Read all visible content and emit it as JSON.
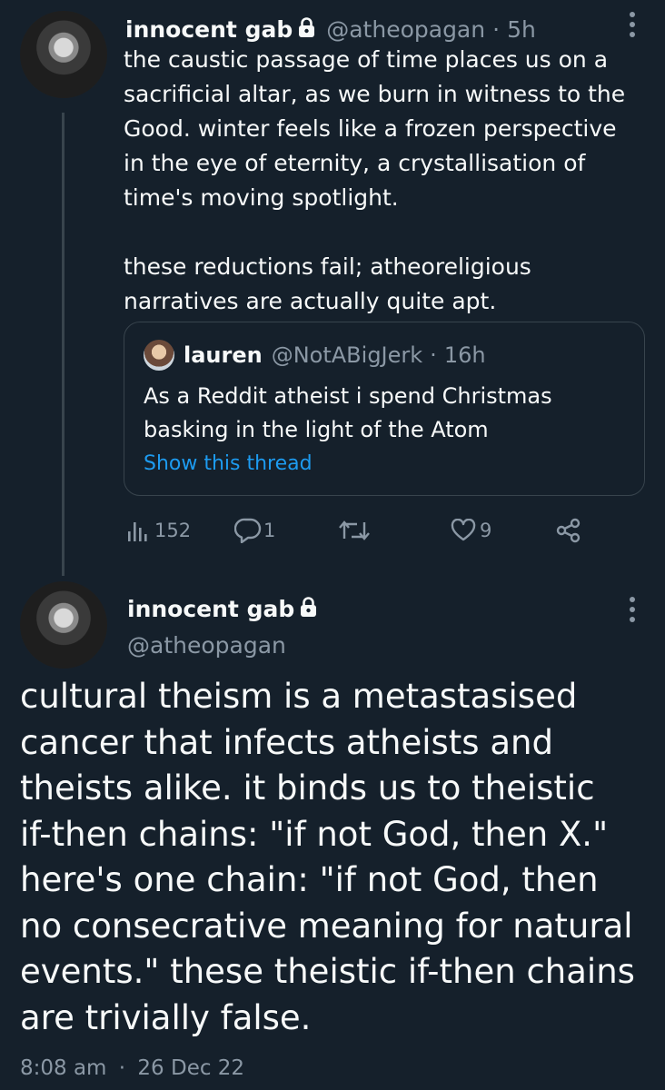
{
  "tweet1": {
    "display_name": "innocent gab",
    "handle": "@atheopagan",
    "sep": "·",
    "time": "5h",
    "text": "the caustic passage of time places us on a\nsacrificial altar, as we burn in witness to the\nGood. winter feels like a frozen perspective\nin the eye of eternity, a crystallisation of\ntime's moving spotlight.\n\nthese reductions fail; atheoreligious\nnarratives are actually quite apt.",
    "quote": {
      "display_name": "lauren",
      "handle": "@NotABigJerk",
      "sep": "·",
      "time": "16h",
      "text": "As a Reddit atheist i spend Christmas\nbasking in the light of the Atom",
      "show_thread": "Show this thread"
    },
    "actions": {
      "views": "152",
      "replies": "1",
      "retweets": "",
      "likes": "9"
    }
  },
  "tweet2": {
    "display_name": "innocent gab",
    "handle": "@atheopagan",
    "text": "cultural theism is a metastasised\ncancer that infects atheists and\ntheists alike. it binds us to theistic\nif-then chains: \"if not God, then X.\"\nhere's one chain: \"if not God, then\nno consecrative meaning for natural\nevents.\" these theistic if-then chains\nare trivially false.",
    "time": "8:08 am",
    "sep": "·",
    "date": "26 Dec 22"
  },
  "colors": {
    "background": "#15202b",
    "text": "#f7f9f9",
    "muted": "#8b98a5",
    "link": "#1d9bf0",
    "border": "#38444d"
  }
}
